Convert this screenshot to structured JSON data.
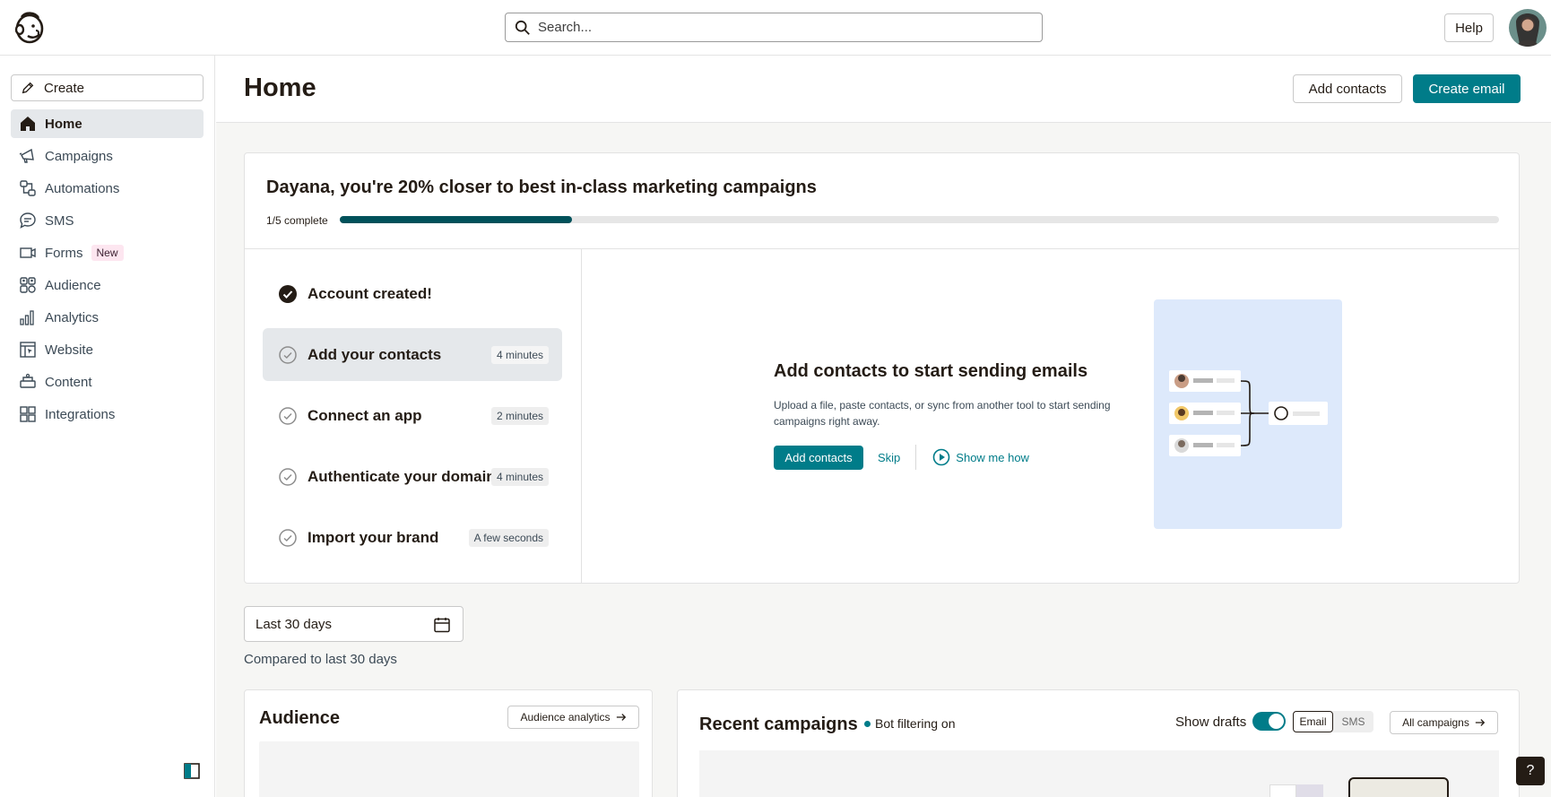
{
  "search": {
    "placeholder": "Search..."
  },
  "header": {
    "help_label": "Help"
  },
  "sidebar": {
    "create_label": "Create",
    "items": [
      {
        "label": "Home",
        "icon": "home-icon"
      },
      {
        "label": "Campaigns",
        "icon": "megaphone-icon"
      },
      {
        "label": "Automations",
        "icon": "automations-icon"
      },
      {
        "label": "SMS",
        "icon": "sms-icon"
      },
      {
        "label": "Forms",
        "icon": "forms-icon",
        "badge": "New"
      },
      {
        "label": "Audience",
        "icon": "audience-icon"
      },
      {
        "label": "Analytics",
        "icon": "analytics-icon"
      },
      {
        "label": "Website",
        "icon": "website-icon"
      },
      {
        "label": "Content",
        "icon": "content-icon"
      },
      {
        "label": "Integrations",
        "icon": "integrations-icon"
      }
    ]
  },
  "main": {
    "title": "Home",
    "add_contacts_label": "Add contacts",
    "create_email_label": "Create email"
  },
  "onboarding": {
    "title": "Dayana, you're 20% closer to best in-class marketing campaigns",
    "progress_label": "1/5 complete",
    "progress_fraction": 0.2,
    "steps": [
      {
        "label": "Account created!",
        "time": ""
      },
      {
        "label": "Add your contacts",
        "time": "4 minutes"
      },
      {
        "label": "Connect an app",
        "time": "2 minutes"
      },
      {
        "label": "Authenticate your domain",
        "time": "4 minutes"
      },
      {
        "label": "Import your brand",
        "time": "A few seconds"
      }
    ],
    "panel": {
      "title": "Add contacts to start sending emails",
      "description": "Upload a file, paste contacts, or sync from another tool to start sending campaigns right away.",
      "primary_label": "Add contacts",
      "skip_label": "Skip",
      "show_label": "Show me how"
    }
  },
  "filters": {
    "date_range": "Last 30 days",
    "compare_label": "Compared to last 30 days"
  },
  "audience_card": {
    "title": "Audience",
    "button_label": "Audience analytics"
  },
  "recent_campaigns": {
    "title": "Recent campaigns",
    "bot_filter_label": "Bot filtering on",
    "show_drafts_label": "Show drafts",
    "show_drafts_on": true,
    "channel_options": [
      "Email",
      "SMS"
    ],
    "selected_channel": "Email",
    "all_label": "All campaigns"
  },
  "help_float_label": "?",
  "colors": {
    "accent": "#007c89",
    "progress_fill": "#00515a",
    "illustration_bg": "#dde9fb"
  }
}
